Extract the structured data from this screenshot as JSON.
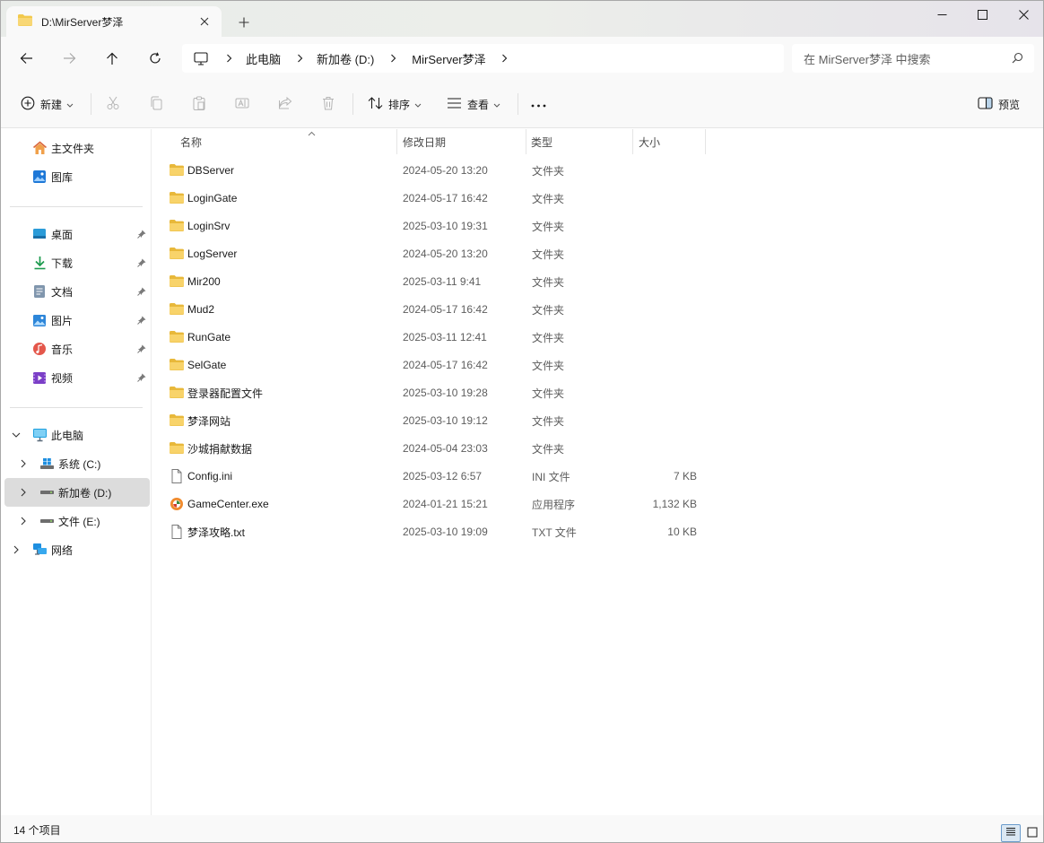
{
  "tab": {
    "title": "D:\\MirServer梦泽"
  },
  "nav": {
    "breadcrumbs": [
      "此电脑",
      "新加卷 (D:)",
      "MirServer梦泽"
    ]
  },
  "search": {
    "placeholder": "在 MirServer梦泽 中搜索"
  },
  "toolbar": {
    "new_label": "新建",
    "sort_label": "排序",
    "view_label": "查看",
    "more_label": "···",
    "preview_label": "预览"
  },
  "sidebar": {
    "quick": [
      {
        "label": "主文件夹",
        "icon": "home-icon"
      },
      {
        "label": "图库",
        "icon": "gallery-icon"
      }
    ],
    "pinned": [
      {
        "label": "桌面",
        "icon": "desktop-icon"
      },
      {
        "label": "下载",
        "icon": "download-icon"
      },
      {
        "label": "文档",
        "icon": "document-icon"
      },
      {
        "label": "图片",
        "icon": "pictures-icon"
      },
      {
        "label": "音乐",
        "icon": "music-icon"
      },
      {
        "label": "视频",
        "icon": "video-icon"
      }
    ],
    "this_pc": "此电脑",
    "drives": [
      {
        "label": "系统 (C:)",
        "icon": "drive-c-icon",
        "selected": false
      },
      {
        "label": "新加卷 (D:)",
        "icon": "drive-icon",
        "selected": true
      },
      {
        "label": "文件 (E:)",
        "icon": "drive-icon",
        "selected": false
      }
    ],
    "network": "网络"
  },
  "columns": {
    "name": "名称",
    "date": "修改日期",
    "type": "类型",
    "size": "大小"
  },
  "files": [
    {
      "name": "DBServer",
      "date": "2024-05-20 13:20",
      "type": "文件夹",
      "size": "",
      "kind": "folder"
    },
    {
      "name": "LoginGate",
      "date": "2024-05-17 16:42",
      "type": "文件夹",
      "size": "",
      "kind": "folder"
    },
    {
      "name": "LoginSrv",
      "date": "2025-03-10 19:31",
      "type": "文件夹",
      "size": "",
      "kind": "folder"
    },
    {
      "name": "LogServer",
      "date": "2024-05-20 13:20",
      "type": "文件夹",
      "size": "",
      "kind": "folder"
    },
    {
      "name": "Mir200",
      "date": "2025-03-11 9:41",
      "type": "文件夹",
      "size": "",
      "kind": "folder"
    },
    {
      "name": "Mud2",
      "date": "2024-05-17 16:42",
      "type": "文件夹",
      "size": "",
      "kind": "folder"
    },
    {
      "name": "RunGate",
      "date": "2025-03-11 12:41",
      "type": "文件夹",
      "size": "",
      "kind": "folder"
    },
    {
      "name": "SelGate",
      "date": "2024-05-17 16:42",
      "type": "文件夹",
      "size": "",
      "kind": "folder"
    },
    {
      "name": "登录器配置文件",
      "date": "2025-03-10 19:28",
      "type": "文件夹",
      "size": "",
      "kind": "folder"
    },
    {
      "name": "梦泽网站",
      "date": "2025-03-10 19:12",
      "type": "文件夹",
      "size": "",
      "kind": "folder"
    },
    {
      "name": "沙城捐献数据",
      "date": "2024-05-04 23:03",
      "type": "文件夹",
      "size": "",
      "kind": "folder"
    },
    {
      "name": "Config.ini",
      "date": "2025-03-12 6:57",
      "type": "INI 文件",
      "size": "7 KB",
      "kind": "file"
    },
    {
      "name": "GameCenter.exe",
      "date": "2024-01-21 15:21",
      "type": "应用程序",
      "size": "1,132 KB",
      "kind": "exe"
    },
    {
      "name": "梦泽攻略.txt",
      "date": "2025-03-10 19:09",
      "type": "TXT 文件",
      "size": "10 KB",
      "kind": "file"
    }
  ],
  "status": {
    "count": "14 个项目"
  },
  "colors": {
    "folder": "#f2c94c",
    "selected_bg": "#dcdcdc",
    "accent": "#0067c0"
  }
}
